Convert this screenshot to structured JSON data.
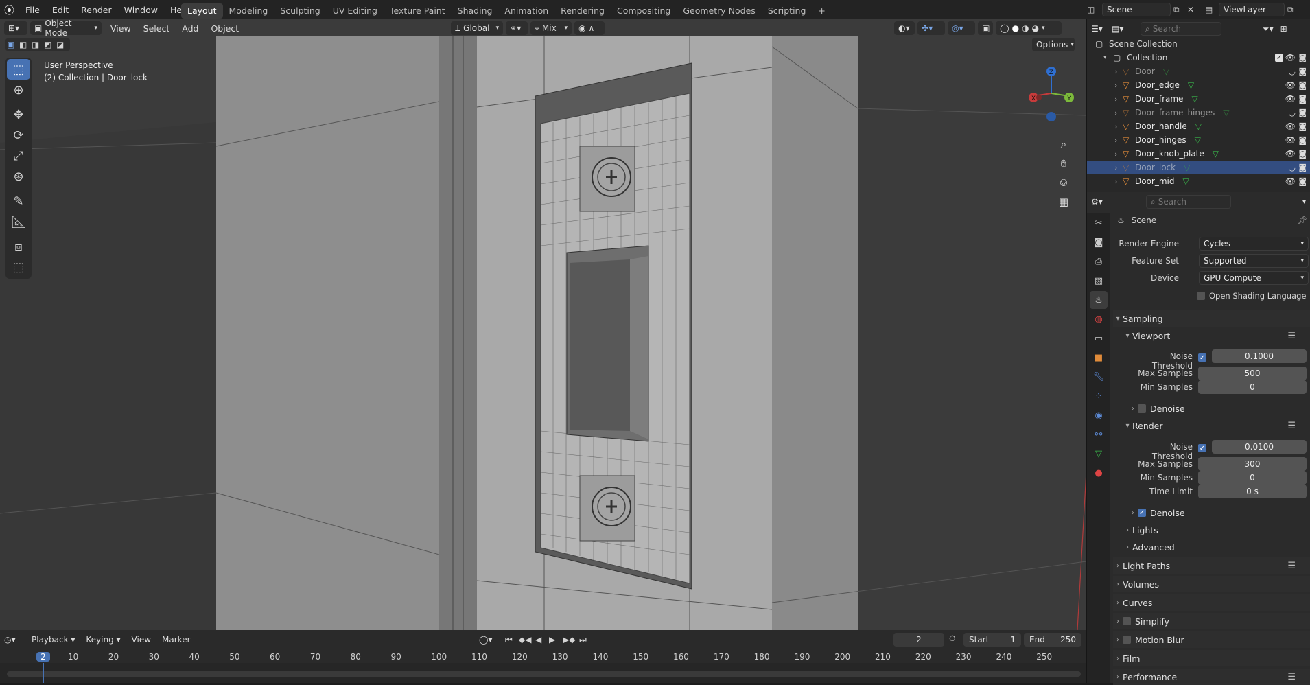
{
  "topbar": {
    "menus": [
      "File",
      "Edit",
      "Render",
      "Window",
      "Help"
    ],
    "workspaces": [
      "Layout",
      "Modeling",
      "Sculpting",
      "UV Editing",
      "Texture Paint",
      "Shading",
      "Animation",
      "Rendering",
      "Compositing",
      "Geometry Nodes",
      "Scripting"
    ],
    "active_workspace": "Layout",
    "add_tab": "+",
    "scene": "Scene",
    "view_layer": "ViewLayer"
  },
  "viewport": {
    "mode": "Object Mode",
    "menus": [
      "View",
      "Select",
      "Add",
      "Object"
    ],
    "orientation": "Global",
    "pivot": "Mix",
    "options": "Options",
    "info_title": "User Perspective",
    "info_subtitle": "(2) Collection | Door_lock",
    "gizmo": {
      "x": "X",
      "y": "Y",
      "z": "Z"
    }
  },
  "timeline": {
    "menus": [
      "Playback",
      "Keying",
      "View",
      "Marker"
    ],
    "current_frame": "2",
    "start_label": "Start",
    "start": "1",
    "end_label": "End",
    "end": "250",
    "ruler": [
      "2",
      "10",
      "20",
      "30",
      "40",
      "50",
      "60",
      "70",
      "80",
      "90",
      "100",
      "110",
      "120",
      "130",
      "140",
      "150",
      "160",
      "170",
      "180",
      "190",
      "200",
      "210",
      "220",
      "230",
      "240",
      "250"
    ]
  },
  "outliner": {
    "search_placeholder": "Search",
    "root": "Scene Collection",
    "collection": "Collection",
    "objects": [
      {
        "name": "Door",
        "selected": false,
        "hidden": true
      },
      {
        "name": "Door_edge",
        "selected": false,
        "hidden": false
      },
      {
        "name": "Door_frame",
        "selected": false,
        "hidden": false
      },
      {
        "name": "Door_frame_hinges",
        "selected": false,
        "hidden": true
      },
      {
        "name": "Door_handle",
        "selected": false,
        "hidden": false
      },
      {
        "name": "Door_hinges",
        "selected": false,
        "hidden": false
      },
      {
        "name": "Door_knob_plate",
        "selected": false,
        "hidden": false
      },
      {
        "name": "Door_lock",
        "selected": true,
        "hidden": true
      },
      {
        "name": "Door_mid",
        "selected": false,
        "hidden": false
      }
    ]
  },
  "properties": {
    "search_placeholder": "Search",
    "context": "Scene",
    "render_engine_label": "Render Engine",
    "render_engine": "Cycles",
    "feature_set_label": "Feature Set",
    "feature_set": "Supported",
    "device_label": "Device",
    "device": "GPU Compute",
    "osl_label": "Open Shading Language",
    "sampling": "Sampling",
    "viewport_panel": "Viewport",
    "render_panel": "Render",
    "noise_threshold_label": "Noise Threshold",
    "max_samples_label": "Max Samples",
    "min_samples_label": "Min Samples",
    "time_limit_label": "Time Limit",
    "denoise_label": "Denoise",
    "viewport_values": {
      "noise_threshold": "0.1000",
      "max_samples": "500",
      "min_samples": "0"
    },
    "render_values": {
      "noise_threshold": "0.0100",
      "max_samples": "300",
      "min_samples": "0",
      "time_limit": "0 s"
    },
    "lights": "Lights",
    "advanced": "Advanced",
    "panels": [
      "Light Paths",
      "Volumes",
      "Curves",
      "Simplify",
      "Motion Blur",
      "Film",
      "Performance"
    ]
  },
  "colors": {
    "accent": "#4772b3",
    "selected_row": "#334d80",
    "object_icon": "#e08b3a",
    "mesh_icon": "#39b54a"
  }
}
